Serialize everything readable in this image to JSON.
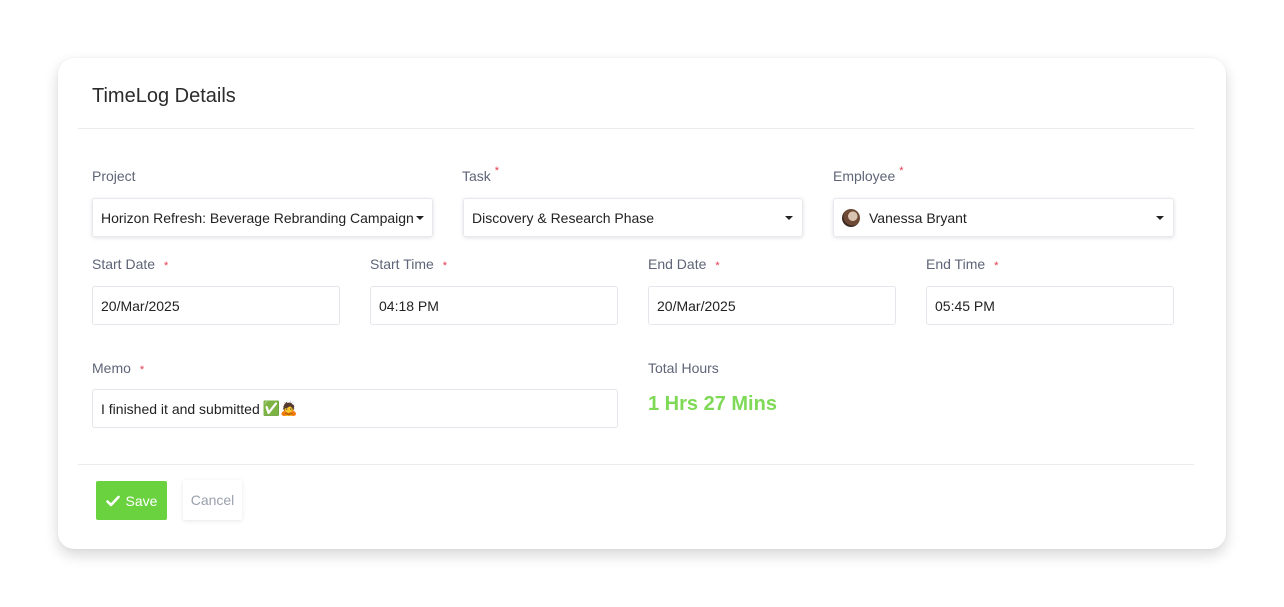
{
  "card": {
    "title": "TimeLog Details"
  },
  "form": {
    "project": {
      "label": "Project",
      "value": "Horizon Refresh: Beverage Rebranding Campaign"
    },
    "task": {
      "label": "Task",
      "required": "*",
      "value": "Discovery & Research Phase"
    },
    "employee": {
      "label": "Employee",
      "required": "*",
      "value": "Vanessa Bryant"
    },
    "start_date": {
      "label": "Start Date",
      "required": "*",
      "value": "20/Mar/2025"
    },
    "start_time": {
      "label": "Start Time",
      "required": "*",
      "value": "04:18 PM"
    },
    "end_date": {
      "label": "End Date",
      "required": "*",
      "value": "20/Mar/2025"
    },
    "end_time": {
      "label": "End Time",
      "required": "*",
      "value": "05:45 PM"
    },
    "memo": {
      "label": "Memo",
      "required": "*",
      "value": "I finished it and submitted",
      "emoji": "✅🙇"
    },
    "total_hours": {
      "label": "Total Hours",
      "value": "1 Hrs 27 Mins"
    }
  },
  "actions": {
    "save_label": "Save",
    "cancel_label": "Cancel"
  },
  "colors": {
    "accent_green": "#6ad13f",
    "total_green": "#7ed957",
    "required_red": "#e53950"
  },
  "icons": {
    "save": "check-icon",
    "dropdown": "caret-down-icon"
  }
}
